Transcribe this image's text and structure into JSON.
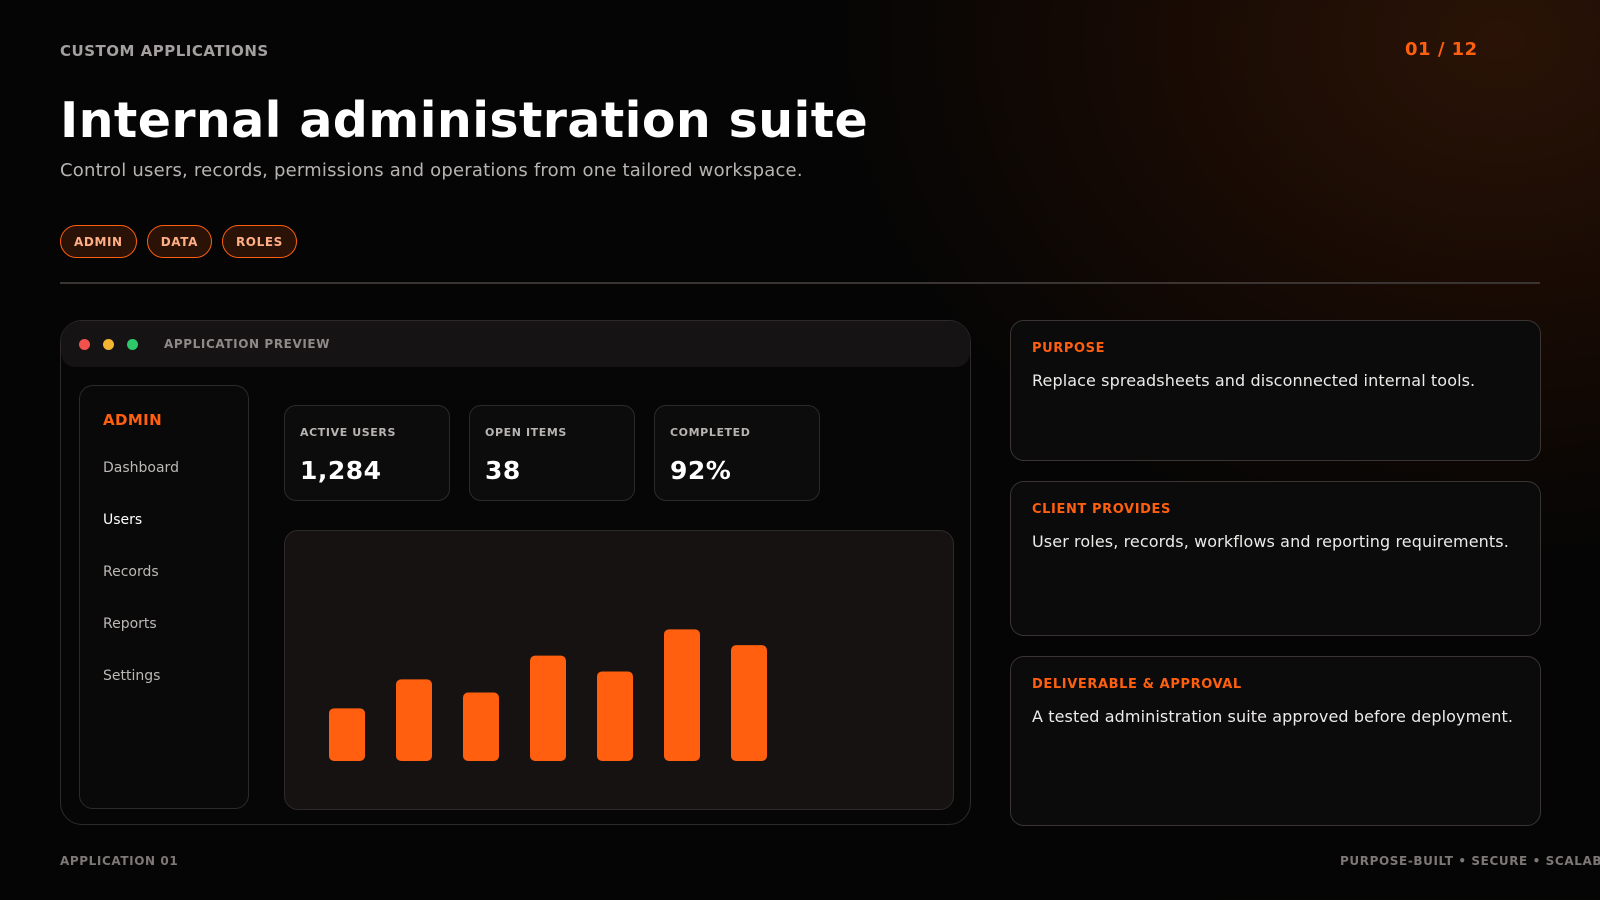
{
  "header": {
    "eyebrow": "CUSTOM APPLICATIONS",
    "pager": "01 / 12",
    "title": "Internal administration suite",
    "subtitle": "Control users, records, permissions and operations from one tailored workspace."
  },
  "tags": [
    "ADMIN",
    "DATA",
    "ROLES"
  ],
  "preview": {
    "label": "APPLICATION PREVIEW",
    "window_dots": [
      "#f2524d",
      "#f5b431",
      "#2ec76a"
    ],
    "sidebar": {
      "title": "ADMIN",
      "items": [
        "Dashboard",
        "Users",
        "Records",
        "Reports",
        "Settings"
      ],
      "active": "Users"
    },
    "stats": [
      {
        "label": "ACTIVE USERS",
        "value": "1,284"
      },
      {
        "label": "OPEN ITEMS",
        "value": "38"
      },
      {
        "label": "COMPLETED",
        "value": "92%"
      }
    ]
  },
  "chart_data": {
    "type": "bar",
    "values": [
      2,
      3.1,
      2.6,
      4,
      3.4,
      5,
      4.4
    ],
    "ylim": [
      0,
      6
    ],
    "color": "#ff5f0f",
    "grid": false
  },
  "cards": [
    {
      "title": "PURPOSE",
      "text": "Replace spreadsheets and disconnected internal tools."
    },
    {
      "title": "CLIENT PROVIDES",
      "text": "User roles, records, workflows and reporting requirements."
    },
    {
      "title": "DELIVERABLE & APPROVAL",
      "text": "A tested administration suite approved before deployment."
    }
  ],
  "footer": {
    "left": "APPLICATION 01",
    "right": "PURPOSE-BUILT • SECURE • SCALABLE"
  },
  "colors": {
    "accent": "#ff5f0f",
    "background": "#050505"
  }
}
